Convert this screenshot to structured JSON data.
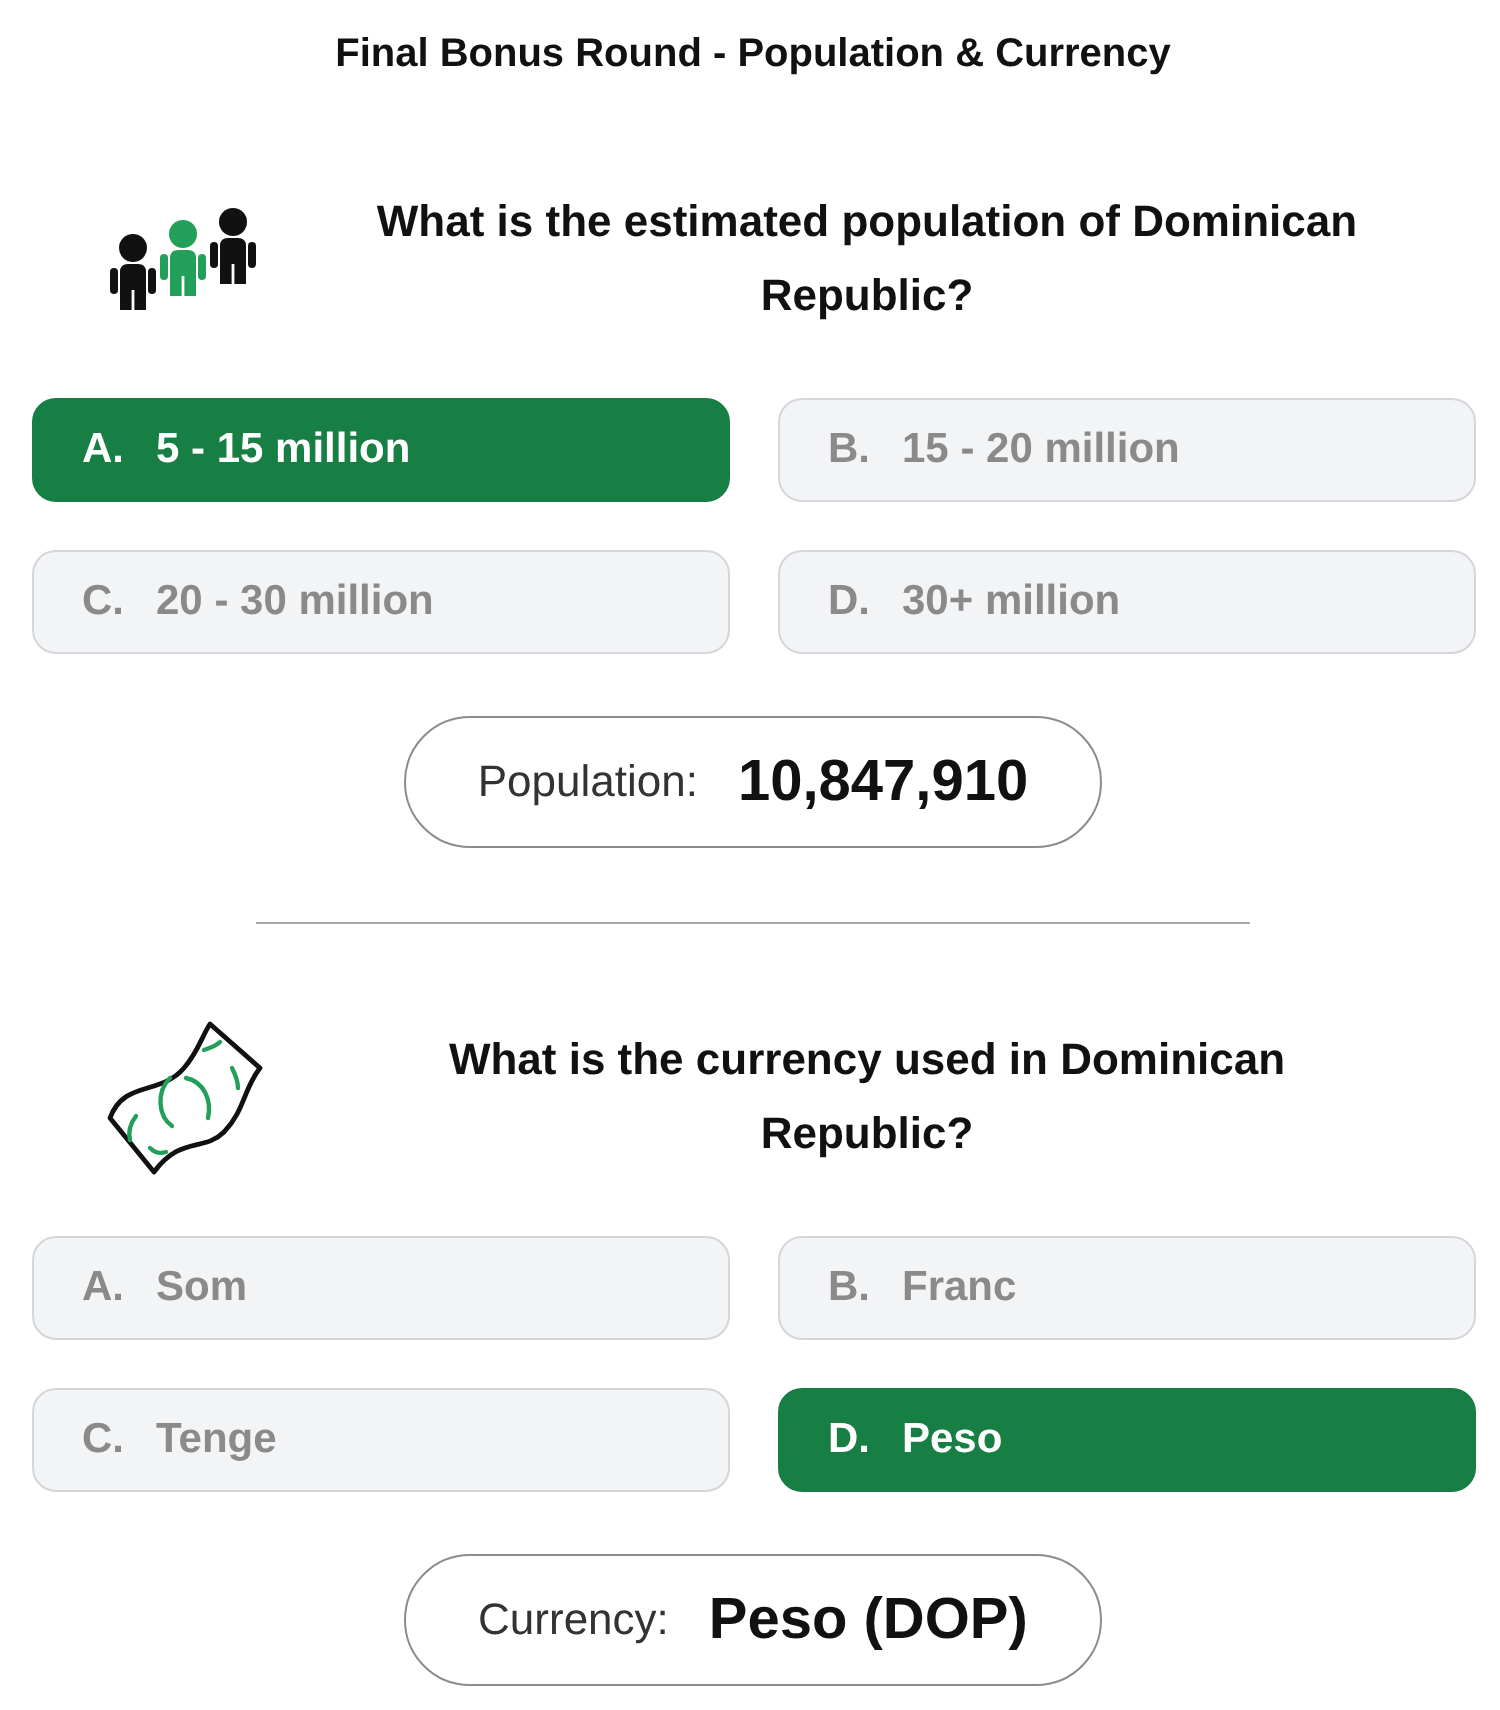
{
  "title": "Final Bonus Round - Population & Currency",
  "questions": [
    {
      "kind": "population",
      "question": "What is the estimated population of Dominican Republic?",
      "options": [
        {
          "letter": "A.",
          "text": "5 - 15 million",
          "selected": true
        },
        {
          "letter": "B.",
          "text": "15 - 20 million",
          "selected": false
        },
        {
          "letter": "C.",
          "text": "20 - 30 million",
          "selected": false
        },
        {
          "letter": "D.",
          "text": "30+ million",
          "selected": false
        }
      ],
      "answer": {
        "label": "Population:",
        "value": "10,847,910"
      }
    },
    {
      "kind": "currency",
      "question": "What is the currency used in Dominican Republic?",
      "options": [
        {
          "letter": "A.",
          "text": "Som",
          "selected": false
        },
        {
          "letter": "B.",
          "text": "Franc",
          "selected": false
        },
        {
          "letter": "C.",
          "text": "Tenge",
          "selected": false
        },
        {
          "letter": "D.",
          "text": "Peso",
          "selected": true
        }
      ],
      "answer": {
        "label": "Currency:",
        "value": "Peso (DOP)"
      }
    }
  ]
}
